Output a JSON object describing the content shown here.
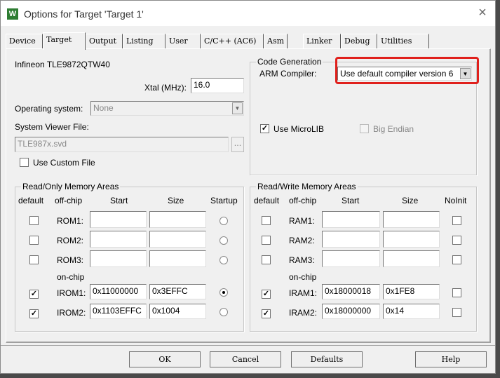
{
  "window": {
    "title": "Options for Target 'Target 1'",
    "close": "×",
    "app_icon": "W"
  },
  "tabs": [
    "Device",
    "Target",
    "Output",
    "Listing",
    "User",
    "C/C++ (AC6)",
    "Asm",
    "Linker",
    "Debug",
    "Utilities"
  ],
  "active_tab": "Target",
  "device_name": "Infineon TLE9872QTW40",
  "xtal": {
    "label": "Xtal (MHz):",
    "value": "16.0"
  },
  "os": {
    "label": "Operating system:",
    "value": "None"
  },
  "svd": {
    "label": "System Viewer File:",
    "value": "TLE987x.svd",
    "browse": "..."
  },
  "custom_file": {
    "label": "Use Custom File",
    "checked": false
  },
  "code_gen": {
    "title": "Code Generation",
    "compiler_label": "ARM Compiler:",
    "compiler_value": "Use default compiler version 6",
    "microlib_label": "Use MicroLIB",
    "microlib_checked": true,
    "bigendian_label": "Big Endian",
    "bigendian_checked": false
  },
  "ro": {
    "title": "Read/Only Memory Areas",
    "headers": {
      "default": "default",
      "offchip": "off-chip",
      "start": "Start",
      "size": "Size",
      "startup": "Startup"
    },
    "onchip": "on-chip",
    "rows": [
      {
        "name": "ROM1:",
        "start": "",
        "size": "",
        "default": false,
        "startup": false
      },
      {
        "name": "ROM2:",
        "start": "",
        "size": "",
        "default": false,
        "startup": false
      },
      {
        "name": "ROM3:",
        "start": "",
        "size": "",
        "default": false,
        "startup": false
      },
      {
        "name": "IROM1:",
        "start": "0x11000000",
        "size": "0x3EFFC",
        "default": true,
        "startup": true
      },
      {
        "name": "IROM2:",
        "start": "0x1103EFFC",
        "size": "0x1004",
        "default": true,
        "startup": false
      }
    ]
  },
  "rw": {
    "title": "Read/Write Memory Areas",
    "headers": {
      "default": "default",
      "offchip": "off-chip",
      "start": "Start",
      "size": "Size",
      "noinit": "NoInit"
    },
    "onchip": "on-chip",
    "rows": [
      {
        "name": "RAM1:",
        "start": "",
        "size": "",
        "default": false,
        "noinit": false
      },
      {
        "name": "RAM2:",
        "start": "",
        "size": "",
        "default": false,
        "noinit": false
      },
      {
        "name": "RAM3:",
        "start": "",
        "size": "",
        "default": false,
        "noinit": false
      },
      {
        "name": "IRAM1:",
        "start": "0x18000018",
        "size": "0x1FE8",
        "default": true,
        "noinit": false
      },
      {
        "name": "IRAM2:",
        "start": "0x18000000",
        "size": "0x14",
        "default": true,
        "noinit": false
      }
    ]
  },
  "buttons": {
    "ok": "OK",
    "cancel": "Cancel",
    "defaults": "Defaults",
    "help": "Help"
  },
  "colors": {
    "highlight": "#e0201c",
    "app_icon": "#2e7d32"
  }
}
